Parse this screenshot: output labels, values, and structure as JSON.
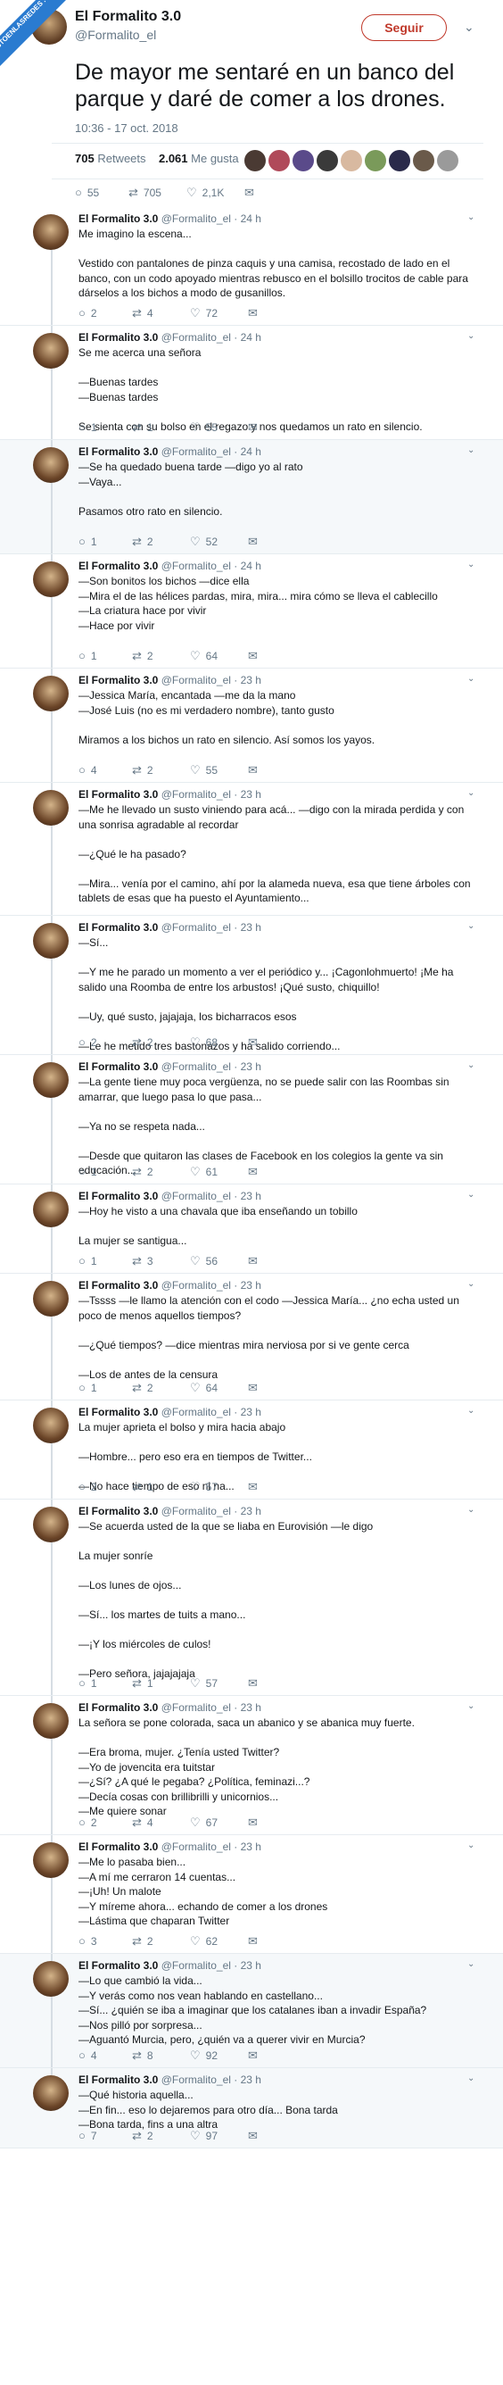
{
  "watermark": "VISTOENLASREDES\n.COM",
  "header": {
    "name": "El Formalito 3.0",
    "handle": "@Formalito_el",
    "follow_label": "Seguir",
    "tweet_text": "De mayor me sentaré en un banco del parque y daré de comer a los drones.",
    "timestamp": "10:36 - 17 oct. 2018",
    "retweets": "705",
    "retweets_label": "Retweets",
    "likes": "2.061",
    "likes_label": "Me gusta",
    "actions": {
      "replies": "55",
      "retweets": "705",
      "likes": "2,1K"
    }
  },
  "replies": [
    {
      "name": "El Formalito 3.0",
      "handle": "@Formalito_el",
      "time": "· 24 h",
      "text": "Me imagino la escena...\n\nVestido con pantalones de pinza caquis y una camisa, recostado de lado en el banco, con un codo apoyado mientras rebusco en el bolsillo trocitos de cable para dárselos a los bichos a modo de gusanillos.",
      "reply_count": "2",
      "retweet_count": "4",
      "like_count": "72"
    },
    {
      "name": "El Formalito 3.0",
      "handle": "@Formalito_el",
      "time": "· 24 h",
      "text": "Se me acerca una señora\n\n—Buenas tardes\n—Buenas tardes\n\nSe sienta con su bolso en el regazo y nos quedamos un rato en silencio.",
      "reply_count": "1",
      "retweet_count": "1",
      "like_count": "55"
    },
    {
      "name": "El Formalito 3.0",
      "handle": "@Formalito_el",
      "time": "· 24 h",
      "text": "—Se ha quedado buena tarde —digo yo al rato\n—Vaya...\n\nPasamos otro rato en silencio.",
      "reply_count": "1",
      "retweet_count": "2",
      "like_count": "52"
    },
    {
      "name": "El Formalito 3.0",
      "handle": "@Formalito_el",
      "time": "· 24 h",
      "text": "—Son bonitos los bichos —dice ella\n—Mira el de las hélices pardas, mira, mira... mira cómo se lleva el cablecillo\n—La criatura hace por vivir\n—Hace por vivir",
      "reply_count": "1",
      "retweet_count": "2",
      "like_count": "64"
    },
    {
      "name": "El Formalito 3.0",
      "handle": "@Formalito_el",
      "time": "· 23 h",
      "text": "—Jessica María, encantada —me da la mano\n—José Luis (no es mi verdadero nombre), tanto gusto\n\nMiramos a los bichos un rato en silencio. Así somos los yayos.",
      "reply_count": "4",
      "retweet_count": "2",
      "like_count": "55"
    },
    {
      "name": "El Formalito 3.0",
      "handle": "@Formalito_el",
      "time": "· 23 h",
      "text": "—Me he llevado un susto viniendo para acá... —digo con la mirada perdida y con una sonrisa agradable al recordar\n\n—¿Qué le ha pasado?\n\n—Mira... venía por el camino, ahí por la alameda nueva, esa que tiene árboles con tablets de esas que ha puesto el Ayuntamiento...",
      "reply_count": "",
      "retweet_count": "",
      "like_count": ""
    },
    {
      "name": "El Formalito 3.0",
      "handle": "@Formalito_el",
      "time": "· 23 h",
      "text": "—Sí...\n\n—Y me he parado un momento a ver el periódico y... ¡Cagonlohmuerto! ¡Me ha salido una Roomba de entre los arbustos! ¡Qué susto, chiquillo!\n\n—Uy, qué susto, jajajaja, los bicharracos esos\n\n—Le he metido tres bastonazos y ha salido corriendo...",
      "reply_count": "2",
      "retweet_count": "2",
      "like_count": "68"
    },
    {
      "name": "El Formalito 3.0",
      "handle": "@Formalito_el",
      "time": "· 23 h",
      "text": "—La gente tiene muy poca vergüenza, no se puede salir con las Roombas sin amarrar, que luego pasa lo que pasa...\n\n—Ya no se respeta nada...\n\n—Desde que quitaron las clases de Facebook en los colegios la gente va sin educación...",
      "reply_count": "1",
      "retweet_count": "2",
      "like_count": "61"
    },
    {
      "name": "El Formalito 3.0",
      "handle": "@Formalito_el",
      "time": "· 23 h",
      "text": "—Hoy he visto a una chavala que iba enseñando un tobillo\n\nLa mujer se santigua...",
      "reply_count": "1",
      "retweet_count": "3",
      "like_count": "56"
    },
    {
      "name": "El Formalito 3.0",
      "handle": "@Formalito_el",
      "time": "· 23 h",
      "text": "—Tssss —le llamo la atención con el codo —Jessica María... ¿no echa usted un poco de menos aquellos tiempos?\n\n—¿Qué tiempos? —dice mientras mira nerviosa por si ve gente cerca\n\n—Los de antes de la censura",
      "reply_count": "1",
      "retweet_count": "2",
      "like_count": "64"
    },
    {
      "name": "El Formalito 3.0",
      "handle": "@Formalito_el",
      "time": "· 23 h",
      "text": "La mujer aprieta el bolso y mira hacia abajo\n\n—Hombre... pero eso era en tiempos de Twitter...\n\n—No hace tiempo de eso ni na...",
      "reply_count": "2",
      "retweet_count": "1",
      "like_count": "57"
    },
    {
      "name": "El Formalito 3.0",
      "handle": "@Formalito_el",
      "time": "· 23 h",
      "text": "—Se acuerda usted de la que se liaba en Eurovisión —le digo\n\nLa mujer sonríe\n\n—Los lunes de ojos...\n\n—Sí... los martes de tuits a mano...\n\n—¡Y los miércoles de culos!\n\n—Pero señora, jajajajaja",
      "reply_count": "1",
      "retweet_count": "1",
      "like_count": "57"
    },
    {
      "name": "El Formalito 3.0",
      "handle": "@Formalito_el",
      "time": "· 23 h",
      "text": "La señora se pone colorada, saca un abanico y se abanica muy fuerte.\n\n—Era broma, mujer. ¿Tenía usted Twitter?\n—Yo de jovencita era tuitstar\n—¿Sí? ¿A qué le pegaba? ¿Política, feminazi...?\n—Decía cosas con brillibrilli y unicornios...\n—Me quiere sonar",
      "reply_count": "2",
      "retweet_count": "4",
      "like_count": "67"
    },
    {
      "name": "El Formalito 3.0",
      "handle": "@Formalito_el",
      "time": "· 23 h",
      "text": "—Me lo pasaba bien...\n—A mí me cerraron 14 cuentas...\n—¡Uh! Un malote\n—Y míreme ahora... echando de comer a los drones\n—Lástima que chaparan Twitter",
      "reply_count": "3",
      "retweet_count": "2",
      "like_count": "62"
    },
    {
      "name": "El Formalito 3.0",
      "handle": "@Formalito_el",
      "time": "· 23 h",
      "text": "—Lo que cambió la vida...\n—Y verás como nos vean hablando en castellano...\n—Sí... ¿quién se iba a imaginar que los catalanes iban a invadir España?\n—Nos pilló por sorpresa...\n—Aguantó Murcia, pero, ¿quién va a querer vivir en Murcia?",
      "reply_count": "4",
      "retweet_count": "8",
      "like_count": "92"
    },
    {
      "name": "El Formalito 3.0",
      "handle": "@Formalito_el",
      "time": "· 23 h",
      "text": "—Qué historia aquella...\n—En fin... eso lo dejaremos para otro día... Bona tarda\n—Bona tarda, fins a una altra",
      "reply_count": "7",
      "retweet_count": "2",
      "like_count": "97"
    }
  ]
}
